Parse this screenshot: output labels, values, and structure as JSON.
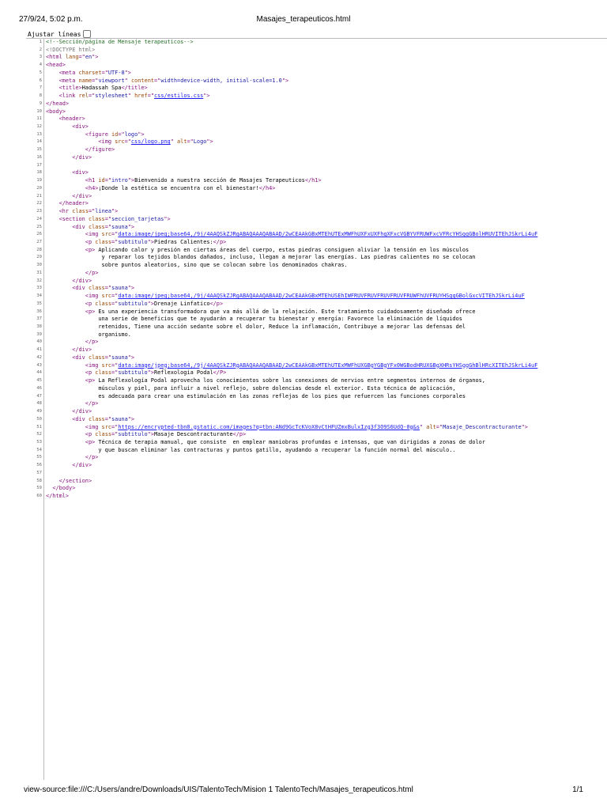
{
  "print_header": {
    "date": "27/9/24, 5:02 p.m.",
    "title": "Masajes_terapeuticos.html"
  },
  "print_footer": {
    "url": "view-source:file:///C:/Users/andre/Downloads/UIS/TalentoTech/Mision 1 TalentoTech/Masajes_terapeuticos.html",
    "page": "1/1"
  },
  "wrap_lines_label": "Ajustar líneas",
  "wrap_lines_checked": false,
  "colors": {
    "tag": "#881280",
    "attr": "#994500",
    "value": "#1a1aa6",
    "link": "#1a1aee",
    "comment": "#236e25"
  },
  "lines": [
    [
      [
        "c",
        "<!--Sección/página de Mensaje terapeuticos-->"
      ]
    ],
    [
      [
        "d",
        "<!DOCTYPE html>"
      ]
    ],
    [
      [
        "t",
        "<html "
      ],
      [
        "a",
        "lang"
      ],
      [
        "t",
        "=\""
      ],
      [
        "v",
        "en"
      ],
      [
        "t",
        "\">"
      ]
    ],
    [
      [
        "t",
        "<head>"
      ]
    ],
    [
      [
        "x",
        "    "
      ],
      [
        "t",
        "<meta "
      ],
      [
        "a",
        "charset"
      ],
      [
        "t",
        "=\""
      ],
      [
        "v",
        "UTF-8"
      ],
      [
        "t",
        "\">"
      ]
    ],
    [
      [
        "x",
        "    "
      ],
      [
        "t",
        "<meta "
      ],
      [
        "a",
        "name"
      ],
      [
        "t",
        "=\""
      ],
      [
        "v",
        "viewport"
      ],
      [
        "t",
        "\" "
      ],
      [
        "a",
        "content"
      ],
      [
        "t",
        "=\""
      ],
      [
        "v",
        "width=device-width, initial-scale=1.0"
      ],
      [
        "t",
        "\">"
      ]
    ],
    [
      [
        "x",
        "    "
      ],
      [
        "t",
        "<title>"
      ],
      [
        "x",
        "Hadassah Spa"
      ],
      [
        "t",
        "</title>"
      ]
    ],
    [
      [
        "x",
        "    "
      ],
      [
        "t",
        "<link "
      ],
      [
        "a",
        "rel"
      ],
      [
        "t",
        "=\""
      ],
      [
        "v",
        "stylesheet"
      ],
      [
        "t",
        "\" "
      ],
      [
        "a",
        "href"
      ],
      [
        "t",
        "=\""
      ],
      [
        "l",
        "css/estilos.css"
      ],
      [
        "t",
        "\">"
      ]
    ],
    [
      [
        "t",
        "</head>"
      ]
    ],
    [
      [
        "t",
        "<body>"
      ]
    ],
    [
      [
        "x",
        "    "
      ],
      [
        "t",
        "<header>"
      ]
    ],
    [
      [
        "x",
        "        "
      ],
      [
        "t",
        "<div>"
      ]
    ],
    [
      [
        "x",
        "            "
      ],
      [
        "t",
        "<figure "
      ],
      [
        "a",
        "id"
      ],
      [
        "t",
        "=\""
      ],
      [
        "v",
        "logo"
      ],
      [
        "t",
        "\">"
      ]
    ],
    [
      [
        "x",
        "                "
      ],
      [
        "t",
        "<img "
      ],
      [
        "a",
        "src"
      ],
      [
        "t",
        "=\""
      ],
      [
        "l",
        "css/logo.png"
      ],
      [
        "t",
        "\" "
      ],
      [
        "a",
        "alt"
      ],
      [
        "t",
        "=\""
      ],
      [
        "v",
        "Logo"
      ],
      [
        "t",
        "\">"
      ]
    ],
    [
      [
        "x",
        "            "
      ],
      [
        "t",
        "</figure>"
      ]
    ],
    [
      [
        "x",
        "        "
      ],
      [
        "t",
        "</div>"
      ]
    ],
    [],
    [
      [
        "x",
        "        "
      ],
      [
        "t",
        "<div>"
      ]
    ],
    [
      [
        "x",
        "            "
      ],
      [
        "t",
        "<h1 "
      ],
      [
        "a",
        "id"
      ],
      [
        "t",
        "=\""
      ],
      [
        "v",
        "intro"
      ],
      [
        "t",
        "\">"
      ],
      [
        "x",
        "Bienvenido a nuestra sección de Masajes Terapeuticos"
      ],
      [
        "t",
        "</h1>"
      ]
    ],
    [
      [
        "x",
        "            "
      ],
      [
        "t",
        "<h4>"
      ],
      [
        "x",
        "¡Donde la estética se encuentra con el bienestar!"
      ],
      [
        "t",
        "</h4>"
      ]
    ],
    [
      [
        "x",
        "        "
      ],
      [
        "t",
        "</div>"
      ]
    ],
    [
      [
        "x",
        "    "
      ],
      [
        "t",
        "</header>"
      ]
    ],
    [
      [
        "x",
        "    "
      ],
      [
        "t",
        "<hr "
      ],
      [
        "a",
        "class"
      ],
      [
        "t",
        "=\""
      ],
      [
        "v",
        "linea"
      ],
      [
        "t",
        "\">"
      ]
    ],
    [
      [
        "x",
        "    "
      ],
      [
        "t",
        "<section "
      ],
      [
        "a",
        "class"
      ],
      [
        "t",
        "=\""
      ],
      [
        "v",
        "seccion_tarjetas"
      ],
      [
        "t",
        "\">"
      ]
    ],
    [
      [
        "x",
        "        "
      ],
      [
        "t",
        "<div "
      ],
      [
        "a",
        "class"
      ],
      [
        "t",
        "=\""
      ],
      [
        "v",
        "sauna"
      ],
      [
        "t",
        "\">"
      ]
    ],
    [
      [
        "x",
        "            "
      ],
      [
        "t",
        "<img "
      ],
      [
        "a",
        "src"
      ],
      [
        "t",
        "=\""
      ],
      [
        "l",
        "data:image/jpeg;base64,/9j/4AAQSkZJRgABAQAAAQABAAD/2wCEAAkGBxMTEhUTExMWFhUXFxUXFhgXFxcVGBYVFRUWFxcVFRcYHSggGBolHRUVITEhJSkrLi4uF"
      ]
    ],
    [
      [
        "x",
        "            "
      ],
      [
        "t",
        "<p "
      ],
      [
        "a",
        "class"
      ],
      [
        "t",
        "=\""
      ],
      [
        "v",
        "subtitulo"
      ],
      [
        "t",
        "\">"
      ],
      [
        "x",
        "Piedras Calientes:"
      ],
      [
        "t",
        "</p>"
      ]
    ],
    [
      [
        "x",
        "            "
      ],
      [
        "t",
        "<p>"
      ],
      [
        "x",
        " Aplicando calor y presión en ciertas áreas del cuerpo, estas piedras consiguen aliviar la tensión en los músculos"
      ]
    ],
    [
      [
        "x",
        "                 y reparar los tejidos blandos dañados, incluso, llegan a mejorar las energías. Las piedras calientes no se colocan"
      ]
    ],
    [
      [
        "x",
        "                 sobre puntos aleatorios, sino que se colocan sobre los denominados chakras."
      ]
    ],
    [
      [
        "x",
        "            "
      ],
      [
        "t",
        "</p>"
      ]
    ],
    [
      [
        "x",
        "        "
      ],
      [
        "t",
        "</div>"
      ]
    ],
    [
      [
        "x",
        "        "
      ],
      [
        "t",
        "<div "
      ],
      [
        "a",
        "class"
      ],
      [
        "t",
        "=\""
      ],
      [
        "v",
        "sauna"
      ],
      [
        "t",
        "\">"
      ]
    ],
    [
      [
        "x",
        "            "
      ],
      [
        "t",
        "<img "
      ],
      [
        "a",
        "src"
      ],
      [
        "t",
        "=\""
      ],
      [
        "l",
        "data:image/jpeg;base64,/9j/4AAQSkZJRgABAQAAAQABAAD/2wCEAAkGBxMTEhUSEhIWFRUVFRUVFRUVFRUVFRUWFhUVFRUYHSggGBolGxcVITEhJSkrLi4uF"
      ]
    ],
    [
      [
        "x",
        "            "
      ],
      [
        "t",
        "<p "
      ],
      [
        "a",
        "class"
      ],
      [
        "t",
        "=\""
      ],
      [
        "v",
        "subtitulo"
      ],
      [
        "t",
        "\">"
      ],
      [
        "x",
        "Drenaje Linfatico"
      ],
      [
        "t",
        "</p>"
      ]
    ],
    [
      [
        "x",
        "            "
      ],
      [
        "t",
        "<p>"
      ],
      [
        "x",
        " Es una experiencia transformadora que va más allá de la relajación. Este tratamiento cuidadosamente diseñado ofrece"
      ]
    ],
    [
      [
        "x",
        "                una serie de beneficios que te ayudarán a recuperar tu bienestar y energía: Favorece la eliminación de líquidos"
      ]
    ],
    [
      [
        "x",
        "                retenidos, Tiene una acción sedante sobre el dolor, Reduce la inflamación, Contribuye a mejorar las defensas del"
      ]
    ],
    [
      [
        "x",
        "                organismo."
      ]
    ],
    [
      [
        "x",
        "            "
      ],
      [
        "t",
        "</p>"
      ]
    ],
    [
      [
        "x",
        "        "
      ],
      [
        "t",
        "</div>"
      ]
    ],
    [
      [
        "x",
        "        "
      ],
      [
        "t",
        "<div "
      ],
      [
        "a",
        "class"
      ],
      [
        "t",
        "=\""
      ],
      [
        "v",
        "sauna"
      ],
      [
        "t",
        "\">"
      ]
    ],
    [
      [
        "x",
        "            "
      ],
      [
        "t",
        "<img "
      ],
      [
        "a",
        "src"
      ],
      [
        "t",
        "=\""
      ],
      [
        "l",
        "data:image/jpeg;base64,/9j/4AAQSkZJRgABAQAAAQABAAD/2wCEAAkGBxMTEhUTExMWFhUXGBgYGBgYFx0WGBodHRUXGBgXHRsYHSggGhBlHRcXITEhJSkrLi4uF"
      ]
    ],
    [
      [
        "x",
        "            "
      ],
      [
        "t",
        "<p "
      ],
      [
        "a",
        "class"
      ],
      [
        "t",
        "=\""
      ],
      [
        "v",
        "subtitulo"
      ],
      [
        "t",
        "\">"
      ],
      [
        "x",
        "Reflexologia Podal"
      ],
      [
        "t",
        "</P>"
      ]
    ],
    [
      [
        "x",
        "            "
      ],
      [
        "t",
        "<p>"
      ],
      [
        "x",
        " La Reflexología Podal aprovecha los conocimientos sobre las conexiones de nervios entre segmentos internos de órganos,"
      ]
    ],
    [
      [
        "x",
        "                músculos y piel, para influir a nivel reflejo, sobre dolencias desde el exterior. Esta técnica de aplicación,"
      ]
    ],
    [
      [
        "x",
        "                es adecuada para crear una estimulación en las zonas reflejas de los pies que refuercen las funciones corporales"
      ]
    ],
    [
      [
        "x",
        "            "
      ],
      [
        "t",
        "</p>"
      ]
    ],
    [
      [
        "x",
        "        "
      ],
      [
        "t",
        "</div>"
      ]
    ],
    [
      [
        "x",
        "        "
      ],
      [
        "t",
        "<div "
      ],
      [
        "a",
        "class"
      ],
      [
        "t",
        "=\""
      ],
      [
        "v",
        "sauna"
      ],
      [
        "t",
        "\">"
      ]
    ],
    [
      [
        "x",
        "            "
      ],
      [
        "t",
        "<img "
      ],
      [
        "a",
        "src"
      ],
      [
        "t",
        "=\""
      ],
      [
        "l",
        "https://encrypted-tbn0.gstatic.com/images?q=tbn:ANd9GcTcKVoX8vCtHFUZmxBulxIzg3f3O9S6UdQ-0g&s"
      ],
      [
        "t",
        "\" "
      ],
      [
        "a",
        "alt"
      ],
      [
        "t",
        "=\""
      ],
      [
        "v",
        "Masaje_Descontracturante"
      ],
      [
        "t",
        "\">"
      ]
    ],
    [
      [
        "x",
        "            "
      ],
      [
        "t",
        "<p "
      ],
      [
        "a",
        "class"
      ],
      [
        "t",
        "=\""
      ],
      [
        "v",
        "subtitulo"
      ],
      [
        "t",
        "\">"
      ],
      [
        "x",
        "Masaje Descontracturante"
      ],
      [
        "t",
        "</p>"
      ]
    ],
    [
      [
        "x",
        "            "
      ],
      [
        "t",
        "<p>"
      ],
      [
        "x",
        " Técnica de terapia manual, que consiste  en emplear maniobras profundas e intensas, que van dirigidas a zonas de dolor"
      ]
    ],
    [
      [
        "x",
        "                y que buscan eliminar las contracturas y puntos gatillo, ayudando a recuperar la función normal del músculo.."
      ]
    ],
    [
      [
        "x",
        "            "
      ],
      [
        "t",
        "</p>"
      ]
    ],
    [
      [
        "x",
        "        "
      ],
      [
        "t",
        "</div>"
      ]
    ],
    [],
    [
      [
        "x",
        "    "
      ],
      [
        "t",
        "</section>"
      ]
    ],
    [
      [
        "x",
        "  "
      ],
      [
        "t",
        "</body>"
      ]
    ],
    [
      [
        "t",
        "</html>"
      ]
    ]
  ]
}
